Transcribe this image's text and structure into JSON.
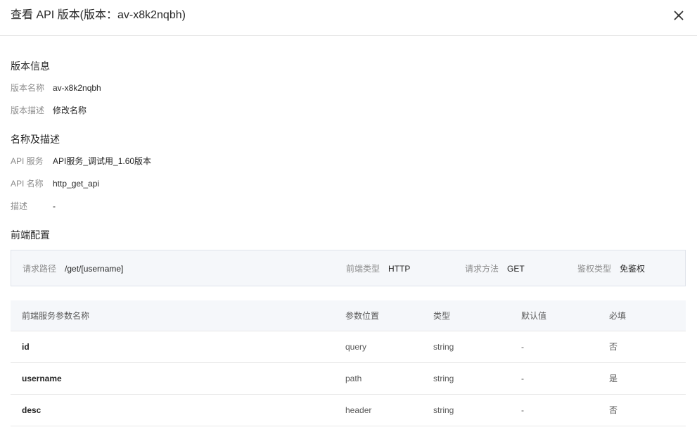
{
  "dialog": {
    "title": "查看 API 版本(版本：av-x8k2nqbh)"
  },
  "version_info": {
    "section_title": "版本信息",
    "fields": [
      {
        "label": "版本名称",
        "value": "av-x8k2nqbh"
      },
      {
        "label": "版本描述",
        "value": "修改名称"
      }
    ]
  },
  "name_desc": {
    "section_title": "名称及描述",
    "fields": [
      {
        "label": "API 服务",
        "value": "API服务_调试用_1.60版本"
      },
      {
        "label": "API 名称",
        "value": "http_get_api"
      },
      {
        "label": "描述",
        "value": "-"
      }
    ]
  },
  "frontend": {
    "section_title": "前端配置",
    "config": [
      {
        "label": "请求路径",
        "value": "/get/[username]"
      },
      {
        "label": "前端类型",
        "value": "HTTP"
      },
      {
        "label": "请求方法",
        "value": "GET"
      },
      {
        "label": "鉴权类型",
        "value": "免鉴权"
      }
    ]
  },
  "params_table": {
    "headers": [
      "前端服务参数名称",
      "参数位置",
      "类型",
      "默认值",
      "必填"
    ],
    "rows": [
      [
        "id",
        "query",
        "string",
        "-",
        "否"
      ],
      [
        "username",
        "path",
        "string",
        "-",
        "是"
      ],
      [
        "desc",
        "header",
        "string",
        "-",
        "否"
      ]
    ]
  }
}
